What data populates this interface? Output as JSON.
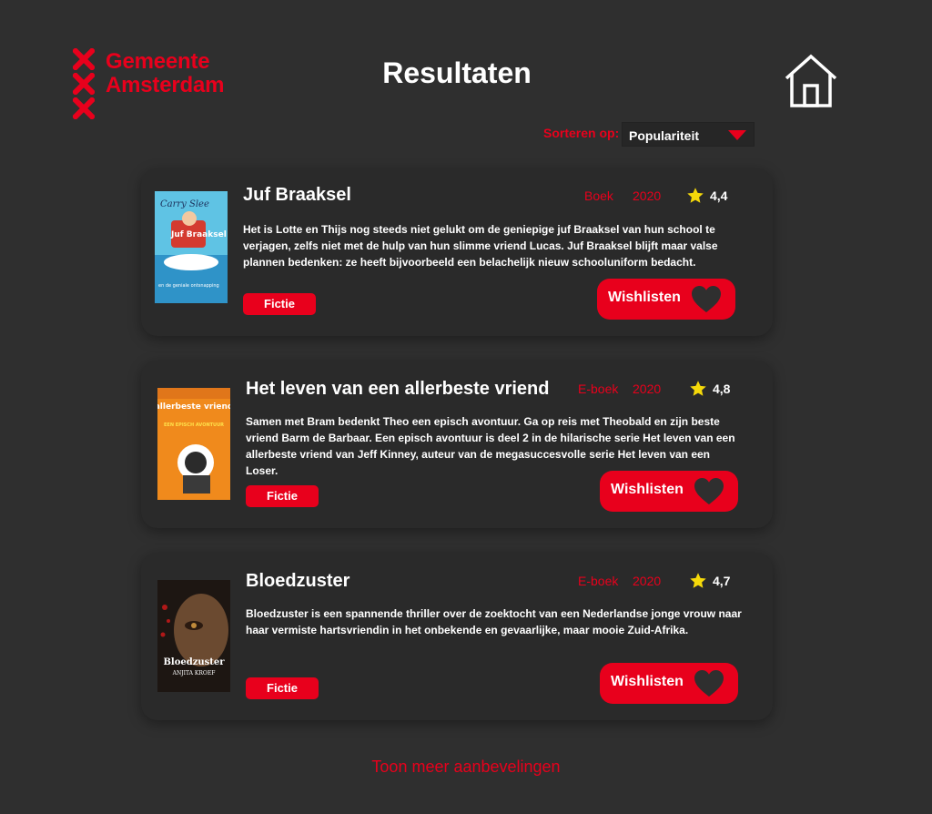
{
  "header": {
    "logo_line1": "Gemeente",
    "logo_line2": "Amsterdam",
    "title": "Resultaten"
  },
  "sort": {
    "label": "Sorteren op:",
    "selected": "Populariteit"
  },
  "results": [
    {
      "title": "Juf Braaksel",
      "type": "Boek",
      "year": "2020",
      "rating": "4,4",
      "description": "Het is Lotte en Thijs nog steeds niet gelukt om de geniepige juf Braaksel van hun school te verjagen, zelfs niet met de hulp van hun slimme vriend Lucas. Juf Braaksel blijft maar valse plannen bedenken: ze heeft bijvoorbeeld een belachelijk nieuw schooluniform bedacht.",
      "genre": "Fictie",
      "wishlist_label": "Wishlisten",
      "cover": {
        "author": "Carry Slee",
        "title": "Juf Braaksel",
        "subtitle": "en de geniale ontsnapping"
      }
    },
    {
      "title": "Het leven van een allerbeste vriend",
      "type": "E-boek",
      "year": "2020",
      "rating": "4,8",
      "description": "Samen met Bram bedenkt Theo een episch avontuur. Ga op reis met Theobald en zijn beste vriend Barm de Barbaar. Een episch avontuur is deel 2 in de hilarische serie Het leven van een allerbeste vriend van Jeff Kinney, auteur van de megasuccesvolle serie Het leven van een Loser.",
      "genre": "Fictie",
      "wishlist_label": "Wishlisten",
      "cover": {
        "title": "allerbeste vriend",
        "subtitle": "EEN EPISCH AVONTUUR"
      }
    },
    {
      "title": "Bloedzuster",
      "type": "E-boek",
      "year": "2020",
      "rating": "4,7",
      "description": "Bloedzuster is een spannende thriller over de zoektocht van een Nederlandse jonge vrouw naar haar vermiste hartsvriendin in het onbekende en gevaarlijke, maar mooie Zuid-Afrika.",
      "genre": "Fictie",
      "wishlist_label": "Wishlisten",
      "cover": {
        "title": "Bloedzuster",
        "author": "ANJITA KROEF"
      }
    }
  ],
  "footer": {
    "more_label": "Toon meer aanbevelingen"
  },
  "colors": {
    "background": "#2f2f2f",
    "card": "#2a2a2a",
    "accent": "#e8001c",
    "star": "#f5d90a"
  },
  "icons": [
    "cross-icon",
    "home-icon",
    "chevron-down-icon",
    "star-icon",
    "heart-icon"
  ]
}
